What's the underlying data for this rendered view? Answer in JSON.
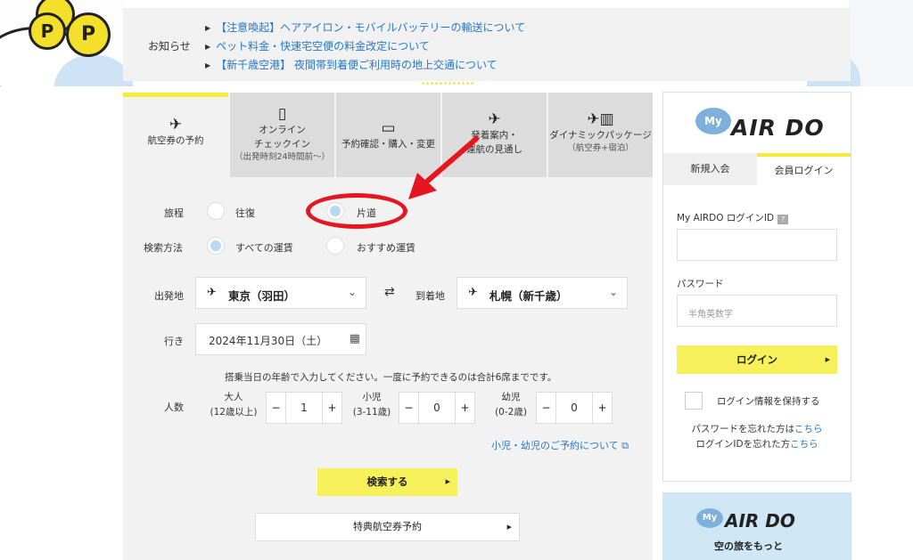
{
  "banner": {
    "coin_letters": [
      "P",
      "P"
    ]
  },
  "news": {
    "label": "お知らせ",
    "items": [
      "【注意喚起】ヘアアイロン・モバイルバッテリーの輸送について",
      "ペット料金・快速宅空便の料金改定について",
      "【新千歳空港】 夜間帯到着便ご利用時の地上交通について"
    ]
  },
  "tabs": [
    {
      "label": "航空券の予約",
      "sub": "",
      "icon": "airplane-icon"
    },
    {
      "label": "オンライン\nチェックイン",
      "sub": "（出発時刻24時間前〜）",
      "icon": "mobile-checkin-icon"
    },
    {
      "label": "予約確認・購入・変更",
      "sub": "",
      "icon": "laptop-icon"
    },
    {
      "label": "発着案内・\n運航の見通し",
      "sub": "",
      "icon": "departure-icon"
    },
    {
      "label": "ダイナミックパッケージ",
      "sub": "（航空券+宿泊）",
      "icon": "plane-hotel-icon"
    }
  ],
  "form": {
    "trip_label": "旅程",
    "trip_options": [
      "往復",
      "片道"
    ],
    "trip_selected": "片道",
    "search_label": "検索方法",
    "search_options": [
      "すべての運賃",
      "おすすめ運賃"
    ],
    "search_selected": "すべての運賃",
    "from_label": "出発地",
    "from_value": "東京（羽田）",
    "to_label": "到着地",
    "to_value": "札幌（新千歳）",
    "date_label": "行き",
    "date_value": "2024年11月30日（土）",
    "pax_note": "搭乗当日の年齢で入力してください。一度に予約できるのは合計6席までです。",
    "pax_label": "人数",
    "passengers": [
      {
        "label": "大人",
        "sub": "(12歳以上)",
        "value": "1"
      },
      {
        "label": "小児",
        "sub": "(3-11歳)",
        "value": "0"
      },
      {
        "label": "幼児",
        "sub": "(0-2歳)",
        "value": "0"
      }
    ],
    "child_link": "小児・幼児のご予約について",
    "search_button": "検索する",
    "award_button": "特典航空券予約"
  },
  "login": {
    "logo_my": "My",
    "logo_text": "AIR DO",
    "tab_new": "新規入会",
    "tab_login": "会員ログイン",
    "id_label": "My AIRDO ログインID",
    "id_value": "",
    "password_label": "パスワード",
    "password_placeholder": "半角英数字",
    "login_button": "ログイン",
    "remember_label": "ログイン情報を保持する",
    "forgot_password": "パスワードを忘れた方は",
    "forgot_id": "ログインIDを忘れた方",
    "here_link": "こちら"
  },
  "promo": {
    "my": "My",
    "title": "AIR DO",
    "subtitle": "空の旅をもっと"
  },
  "colors": {
    "accent_yellow": "#f6f05a",
    "link_blue": "#2479c9",
    "annotation_red": "#e5161f",
    "radio_selected": "#b9d8f5"
  }
}
